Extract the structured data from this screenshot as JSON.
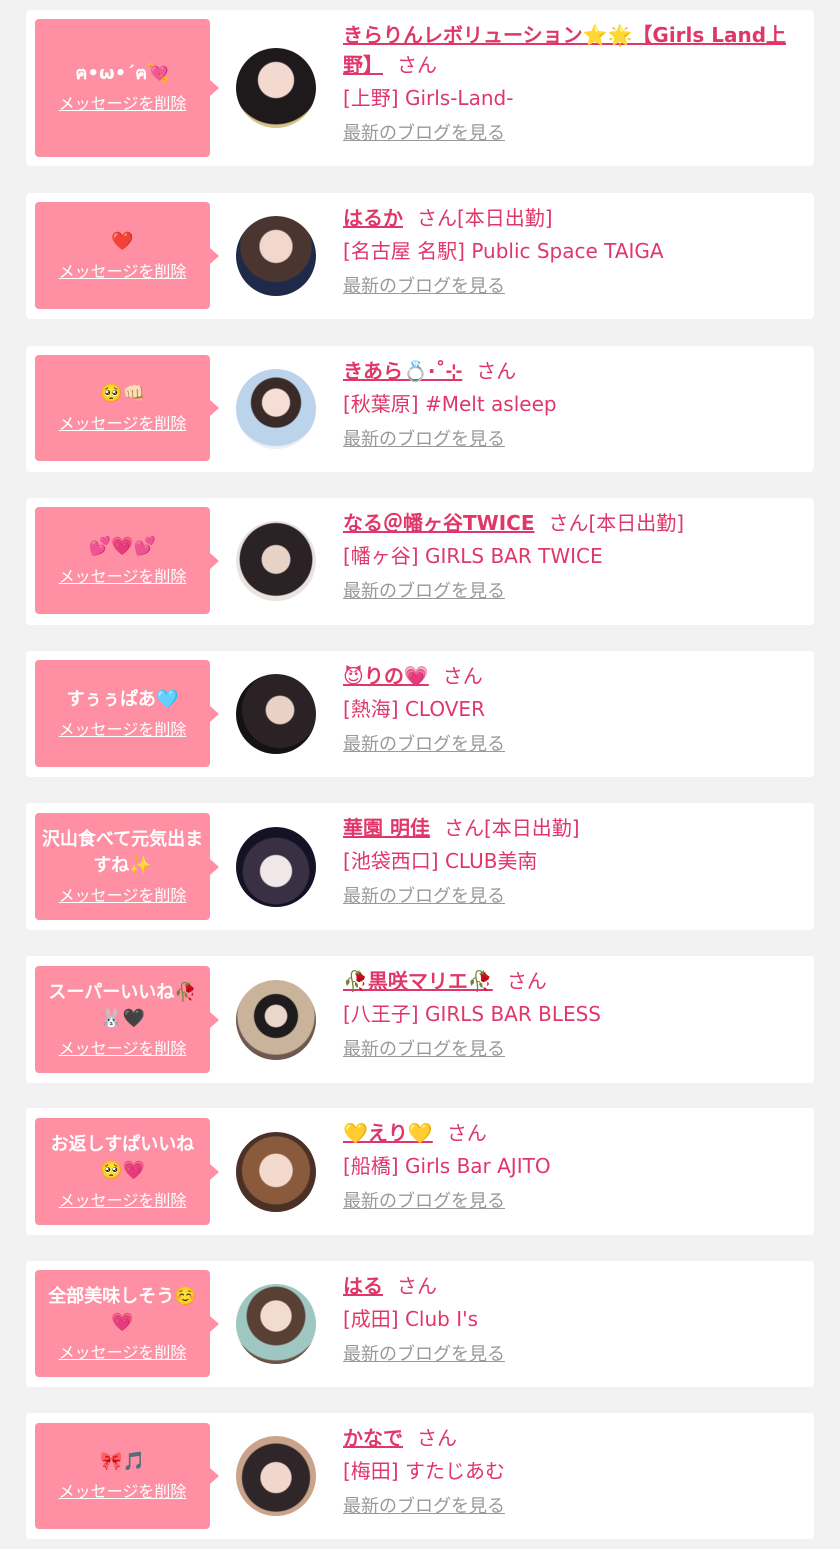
{
  "colors": {
    "accent": "#e0376b",
    "bubble": "#ff8fa3",
    "background": "#f2f2f2",
    "muted_link": "#999999"
  },
  "delete_label": "メッセージを削除",
  "blog_label": "最新のブログを見る",
  "san_label": "さん",
  "cards": [
    {
      "message": "ฅ•ω•´ฅ💘",
      "name": "きらりんレボリューション⭐🌟【Girls Land上野】",
      "status": "",
      "shop": "[上野] Girls-Land-"
    },
    {
      "message": "❤️",
      "name": "はるか",
      "status": "[本日出勤]",
      "shop": "[名古屋 名駅] Public Space TAIGA"
    },
    {
      "message": "🥺👊🏻",
      "name": "きあら💍·˚⊹",
      "status": "",
      "shop": "[秋葉原] #Melt asleep"
    },
    {
      "message": "💕💗💕",
      "name": "なる＠幡ヶ谷TWICE",
      "status": "[本日出勤]",
      "shop": "[幡ヶ谷] GIRLS BAR TWICE"
    },
    {
      "message": "すぅぅぱあ🩵",
      "name": "😈りの💗",
      "status": "",
      "shop": "[熱海] CLOVER"
    },
    {
      "message": "沢山食べて元気出ますね✨",
      "name": "華園 明佳",
      "status": "[本日出勤]",
      "shop": "[池袋西口] CLUB美南"
    },
    {
      "message": "スーパーいいね🥀🐰🖤",
      "name": "🥀黒咲マリエ🥀",
      "status": "",
      "shop": "[八王子] GIRLS BAR BLESS"
    },
    {
      "message": "お返しすぱいいね🥺💗",
      "name": "💛えり💛",
      "status": "",
      "shop": "[船橋] Girls Bar AJITO"
    },
    {
      "message": "全部美味しそう☺️💗",
      "name": "はる",
      "status": "",
      "shop": "[成田] Club I's"
    },
    {
      "message": "🎀🎵",
      "name": "かなで",
      "status": "",
      "shop": "[梅田] すたじあむ"
    }
  ]
}
